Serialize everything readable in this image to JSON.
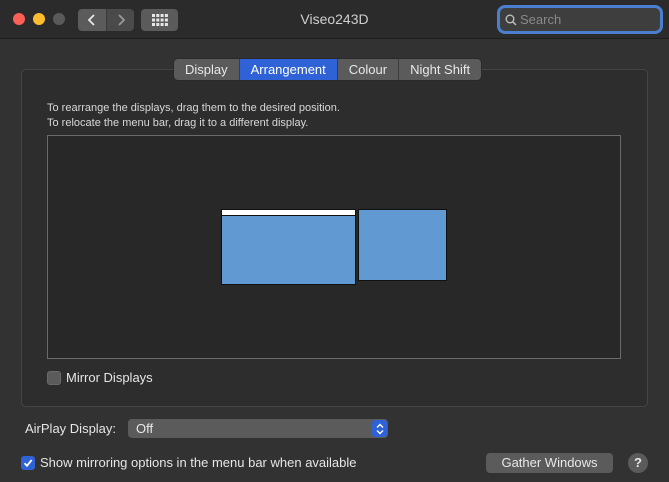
{
  "window": {
    "title": "Viseo243D"
  },
  "toolbar": {
    "search_placeholder": "Search",
    "search_value": ""
  },
  "tabs": [
    {
      "label": "Display",
      "active": false
    },
    {
      "label": "Arrangement",
      "active": true
    },
    {
      "label": "Colour",
      "active": false
    },
    {
      "label": "Night Shift",
      "active": false
    }
  ],
  "arrangement": {
    "instruction_line1": "To rearrange the displays, drag them to the desired position.",
    "instruction_line2": "To relocate the menu bar, drag it to a different display."
  },
  "mirror_displays": {
    "label": "Mirror Displays",
    "checked": false
  },
  "airplay": {
    "label": "AirPlay Display:",
    "selected": "Off"
  },
  "show_mirroring": {
    "label": "Show mirroring options in the menu bar when available",
    "checked": true
  },
  "buttons": {
    "gather_windows": "Gather Windows",
    "help": "?"
  },
  "colors": {
    "accent": "#2f62d6",
    "display_fill": "#6199d3",
    "close": "#fe5f57",
    "minimize": "#febc2e"
  }
}
